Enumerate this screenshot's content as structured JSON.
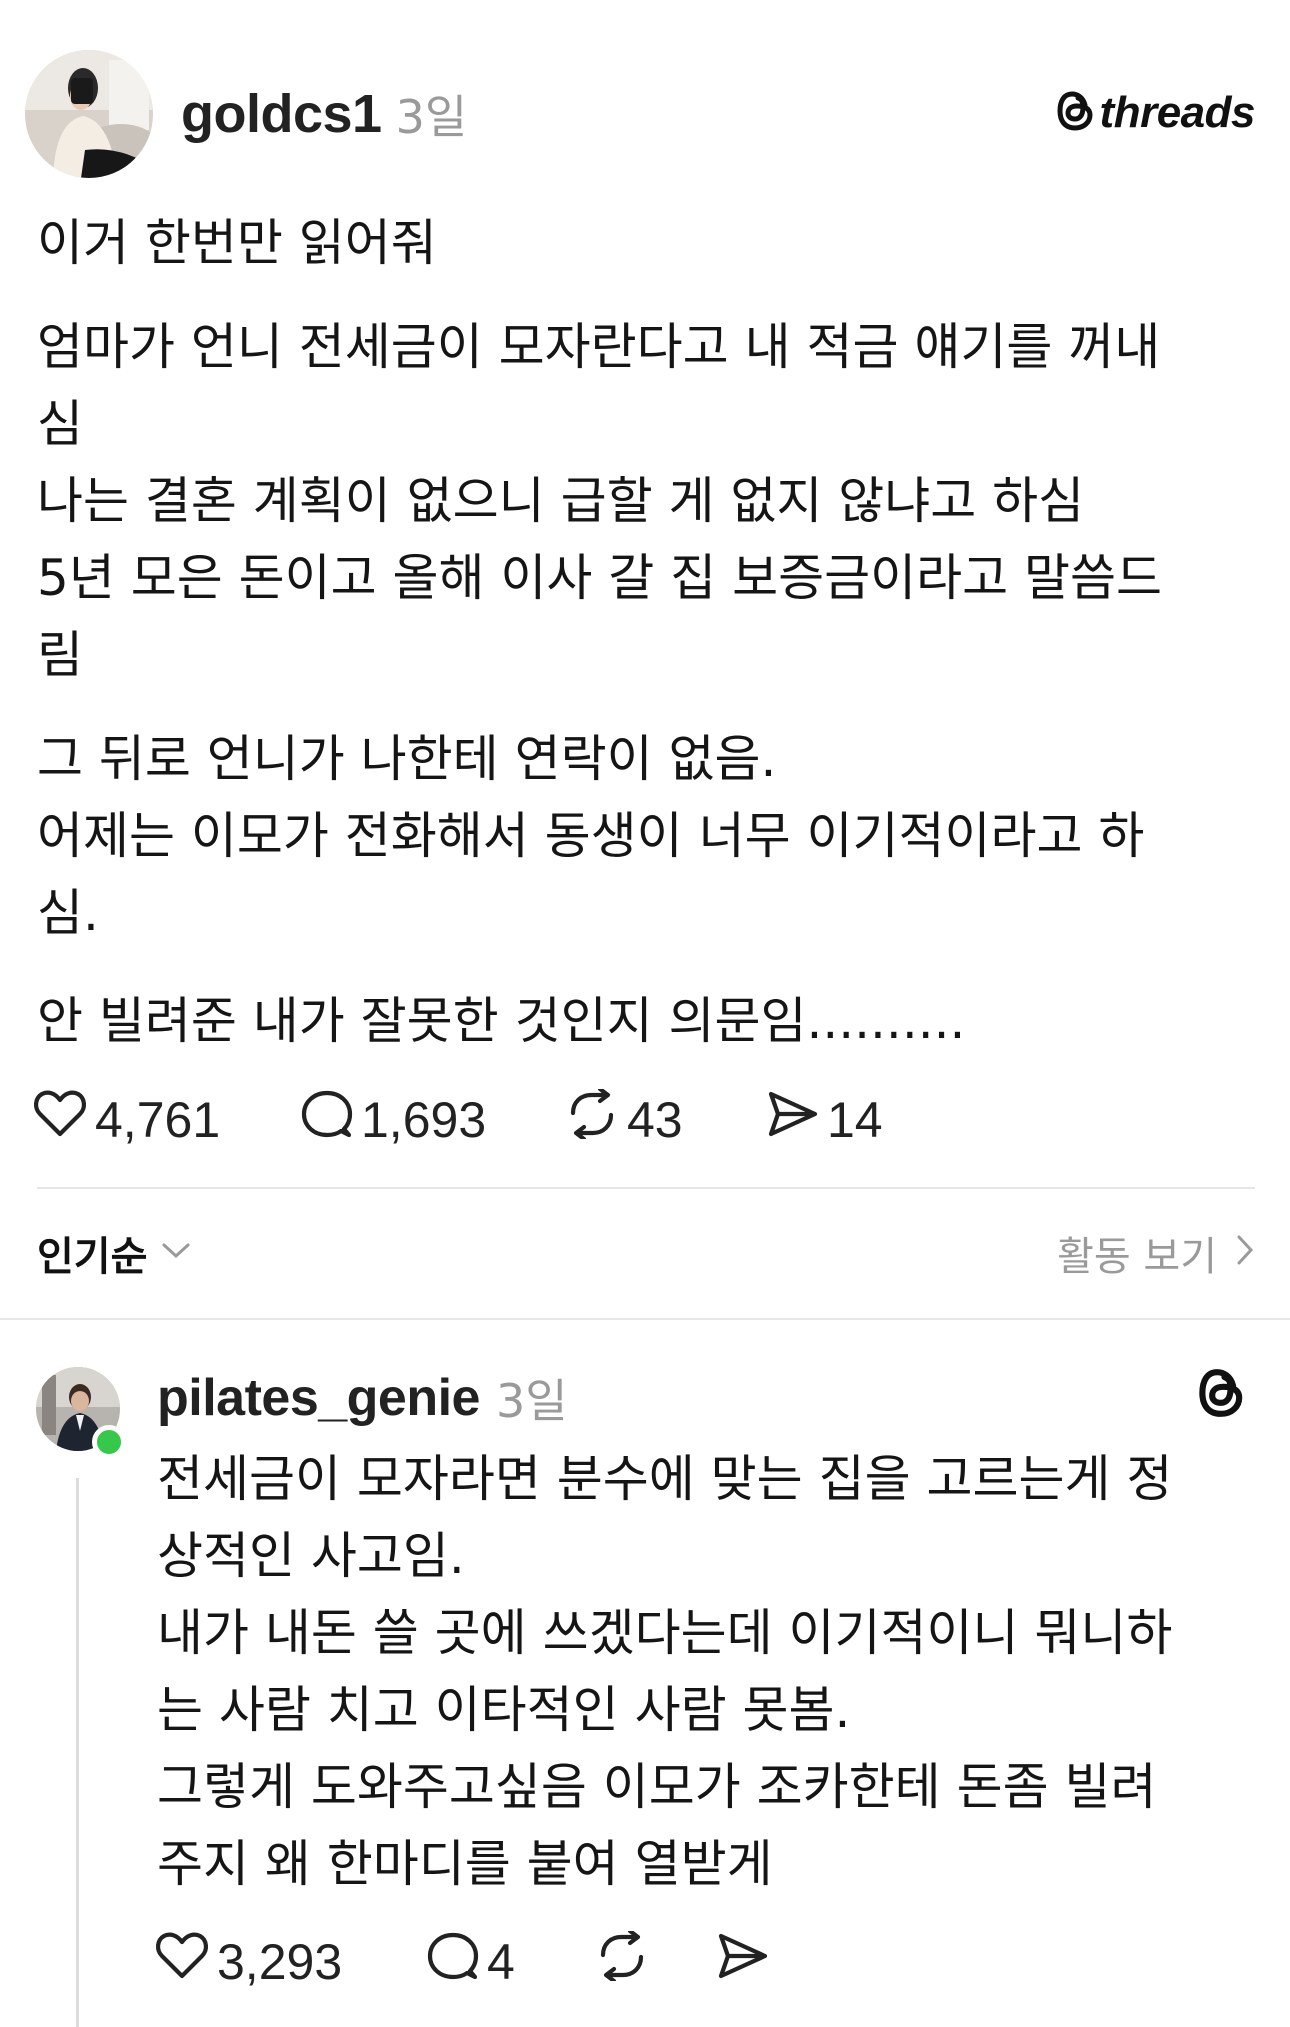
{
  "post": {
    "author": "goldcs1",
    "time": "3일",
    "brand": "threads",
    "paragraphs": [
      "이거 한번만 읽어줘",
      "엄마가 언니 전세금이 모자란다고 내 적금 얘기를 꺼내\n심\n나는 결혼 계획이 없으니 급할 게 없지 않냐고 하심\n5년 모은 돈이고 올해 이사 갈 집 보증금이라고 말씀드\n림",
      "그 뒤로 언니가 나한테 연락이 없음.\n어제는 이모가 전화해서 동생이 너무 이기적이라고 하\n심.",
      "안 빌려준 내가 잘못한 것인지 의문임.........."
    ],
    "stats": {
      "likes": "4,761",
      "comments": "1,693",
      "reposts": "43",
      "shares": "14"
    }
  },
  "sort": {
    "label": "인기순",
    "activity": "활동 보기"
  },
  "reply": {
    "author": "pilates_genie",
    "time": "3일",
    "text": "전세금이 모자라면 분수에 맞는 집을 고르는게 정\n상적인 사고임.\n내가 내돈 쓸 곳에 쓰겠다는데 이기적이니 뭐니하\n는 사람 치고 이타적인 사람 못봄.\n그렇게 도와주고싶음 이모가 조카한테 돈좀 빌려\n주지 왜 한마디를 붙여 열받게",
    "stats": {
      "likes": "3,293",
      "comments": "4"
    }
  },
  "colors": {
    "text": "#151515",
    "muted": "#9a9a9a",
    "divider": "#e6e6e6",
    "online": "#35c84a"
  }
}
